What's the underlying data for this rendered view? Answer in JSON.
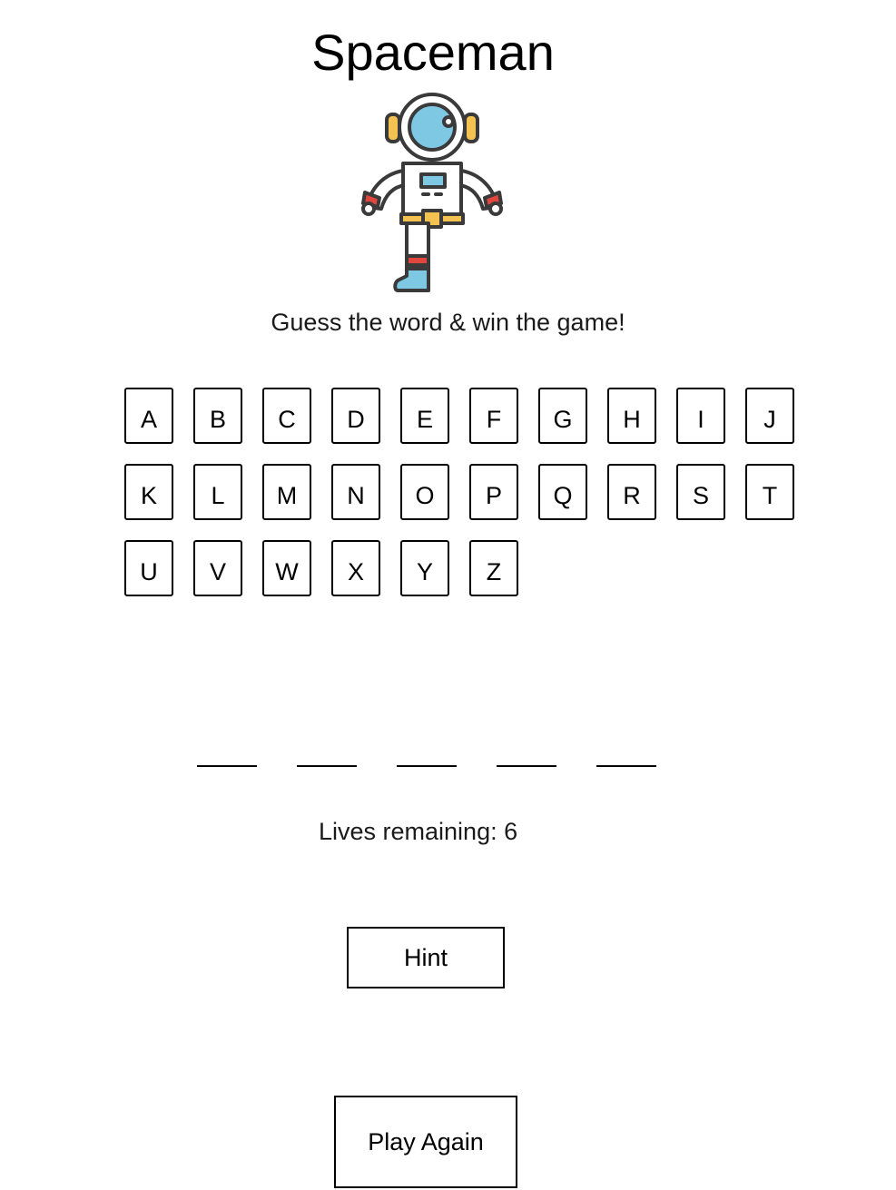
{
  "game": {
    "title": "Spaceman",
    "tagline": "Guess the word & win the game!",
    "lives_label": "Lives remaining: 6",
    "lives_remaining": 6,
    "word_length": 5
  },
  "keyboard": {
    "letters": [
      "A",
      "B",
      "C",
      "D",
      "E",
      "F",
      "G",
      "H",
      "I",
      "J",
      "K",
      "L",
      "M",
      "N",
      "O",
      "P",
      "Q",
      "R",
      "S",
      "T",
      "U",
      "V",
      "W",
      "X",
      "Y",
      "Z"
    ]
  },
  "buttons": {
    "hint_label": "Hint",
    "play_again_label": "Play Again"
  },
  "illustration": {
    "icon": "astronaut-icon",
    "colors": {
      "visor": "#7ec8e3",
      "outline": "#3a3a3a",
      "accent_red": "#e0463e",
      "accent_yellow": "#f3c250",
      "boot": "#7ec8e3"
    }
  }
}
